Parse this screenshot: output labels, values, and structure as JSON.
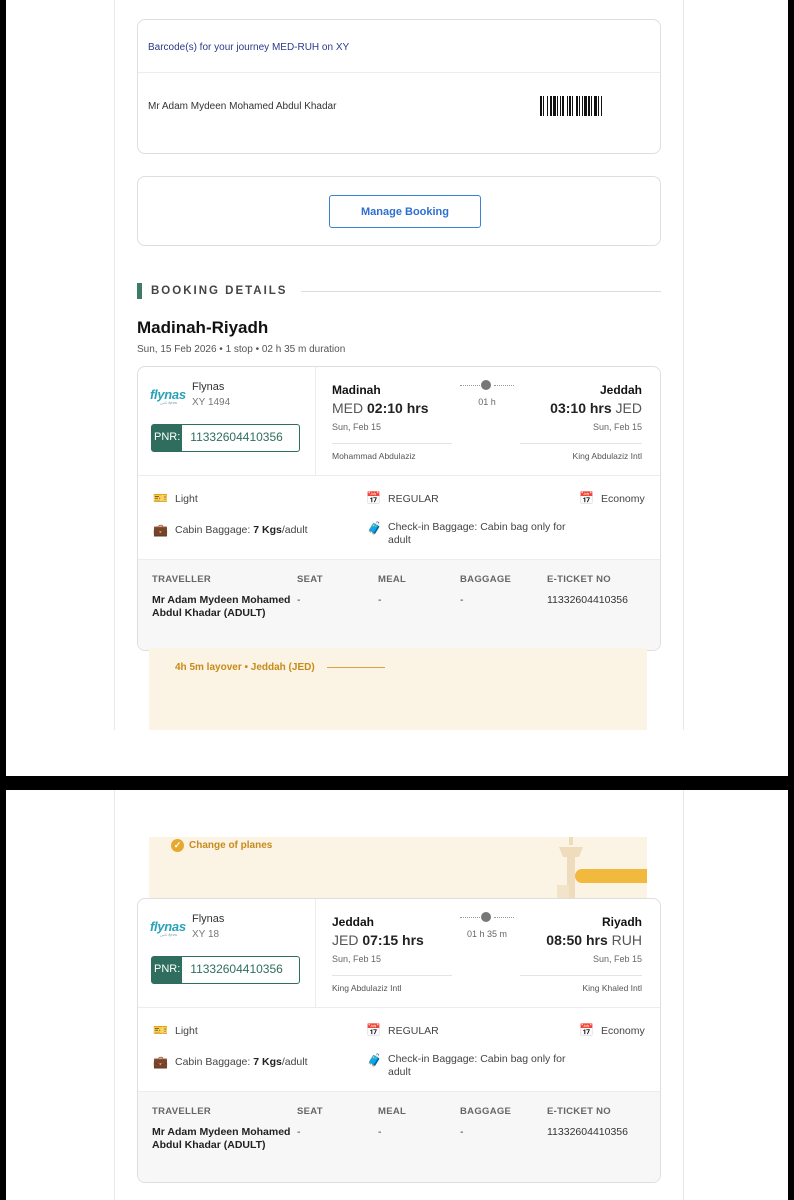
{
  "barcode_card": {
    "title": "Barcode(s) for your journey MED-RUH on XY",
    "passenger": "Mr Adam Mydeen Mohamed Abdul Khadar"
  },
  "manage": {
    "label": "Manage Booking"
  },
  "booking_details": {
    "heading": "BOOKING DETAILS",
    "route": "Madinah-Riyadh",
    "summary": "Sun, 15 Feb 2026 • 1 stop • 02 h 35 m duration"
  },
  "segments": [
    {
      "logo": "flynas",
      "airline": "Flynas",
      "flight": "XY 1494",
      "pnr_label": "PNR:",
      "pnr": "11332604410356",
      "dep_city": "Madinah",
      "dep_code": "MED",
      "dep_time": "02:10 hrs",
      "dep_date": "Sun, Feb 15",
      "dep_airport": "Mohammad Abdulaziz",
      "duration": "01 h",
      "arr_city": "Jeddah",
      "arr_code": "JED",
      "arr_time": "03:10 hrs",
      "arr_date": "Sun, Feb 15",
      "arr_airport": "King Abdulaziz Intl",
      "fare_type": "Light",
      "fare_class": "REGULAR",
      "cabin": "Economy",
      "cabin_baggage_label": "Cabin Baggage: ",
      "cabin_baggage_value": "7 Kgs",
      "cabin_baggage_suffix": "/adult",
      "checkin_baggage": "Check-in Baggage: Cabin bag only for adult",
      "traveller": "Mr Adam Mydeen Mohamed Abdul Khadar (ADULT)",
      "seat": "-",
      "meal": "-",
      "baggage": "-",
      "eticket": "11332604410356"
    },
    {
      "logo": "flynas",
      "airline": "Flynas",
      "flight": "XY 18",
      "pnr_label": "PNR:",
      "pnr": "11332604410356",
      "dep_city": "Jeddah",
      "dep_code": "JED",
      "dep_time": "07:15 hrs",
      "dep_date": "Sun, Feb 15",
      "dep_airport": "King Abdulaziz Intl",
      "duration": "01 h 35 m",
      "arr_city": "Riyadh",
      "arr_code": "RUH",
      "arr_time": "08:50 hrs",
      "arr_date": "Sun, Feb 15",
      "arr_airport": "King Khaled Intl",
      "fare_type": "Light",
      "fare_class": "REGULAR",
      "cabin": "Economy",
      "cabin_baggage_label": "Cabin Baggage: ",
      "cabin_baggage_value": "7 Kgs",
      "cabin_baggage_suffix": "/adult",
      "checkin_baggage": "Check-in Baggage: Cabin bag only for adult",
      "traveller": "Mr Adam Mydeen Mohamed Abdul Khadar (ADULT)",
      "seat": "-",
      "meal": "-",
      "baggage": "-",
      "eticket": "11332604410356"
    }
  ],
  "table_headers": {
    "traveller": "TRAVELLER",
    "seat": "SEAT",
    "meal": "MEAL",
    "baggage": "BAGGAGE",
    "eticket": "E-TICKET NO"
  },
  "layover": {
    "text": "4h 5m layover • Jeddah (JED)",
    "change": "Change of planes"
  },
  "colors": {
    "accent_green": "#2f6e5e",
    "link_blue": "#2f6fd0",
    "layover_bg": "#fbf3e4",
    "layover_text": "#c88a19"
  }
}
